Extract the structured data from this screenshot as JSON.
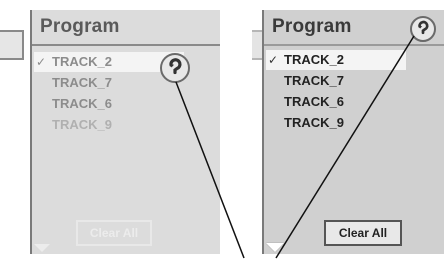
{
  "left_panel": {
    "title": "Program",
    "check_mark": "✓",
    "tracks": [
      "TRACK_2",
      "TRACK_7",
      "TRACK_6",
      "TRACK_9"
    ],
    "clear_button_label": "Clear All",
    "icon": "return-icon"
  },
  "right_panel": {
    "title": "Program",
    "check_mark": "✓",
    "tracks": [
      "TRACK_2",
      "TRACK_7",
      "TRACK_6",
      "TRACK_9"
    ],
    "clear_button_label": "Clear All",
    "icon": "return-icon"
  }
}
